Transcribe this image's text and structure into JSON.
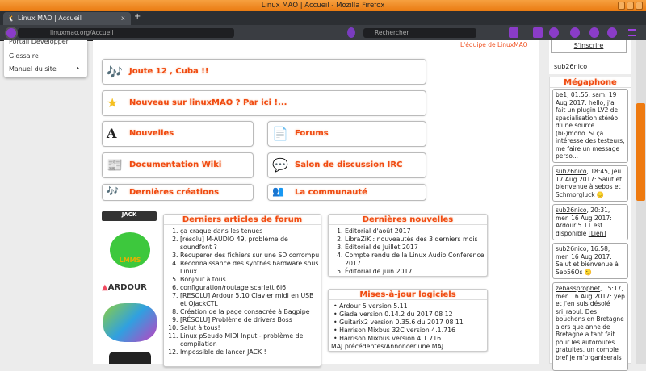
{
  "window": {
    "title": "Linux MAO | Accueil - Mozilla Firefox"
  },
  "tab": {
    "label": "Linux MAO | Accueil",
    "close": "x",
    "new_tab": "+"
  },
  "nav": {
    "url": "linuxmao.org/Accueil",
    "search_placeholder": "Rechercher"
  },
  "sidebar": {
    "items": [
      {
        "label": "Portail Développer"
      },
      {
        "label": "Glossaire"
      },
      {
        "label": "Manuel du site"
      }
    ]
  },
  "main": {
    "signature": "L'équipe de LinuxMAO",
    "buttons": [
      {
        "label": "Joute 12 , Cuba !!"
      },
      {
        "label": "Nouveau sur linuxMAO ? Par ici !..."
      },
      {
        "label": "Nouvelles"
      },
      {
        "label": "Forums"
      },
      {
        "label": "Documentation Wiki"
      },
      {
        "label": "Salon de discussion IRC"
      },
      {
        "label": "Dernières créations"
      },
      {
        "label": "La communauté"
      }
    ],
    "logos": [
      "JACK",
      "LMMS",
      "ARDOUR"
    ],
    "forum": {
      "title": "Derniers articles de forum",
      "items": [
        "ça craque dans les tenues",
        "[résolu] M-AUDIO 49, problème de soundfont ?",
        "Recuperer des fichiers sur une SD corrompu",
        "Reconnaissance des synthés hardware sous Linux",
        "Bonjour à tous",
        "configuration/routage scarlett 6i6",
        "[RESOLU] Ardour 5.10 Clavier midi en USB et QjackCTL",
        "Création de la page consacrée à Bagpipe",
        "[RÉSOLU] Problème de drivers Boss",
        "Salut à tous!",
        "Linux pSeudo MIDI Input - problème de compilation",
        "Impossible de lancer JACK !"
      ]
    },
    "news": {
      "title": "Dernières nouvelles",
      "items": [
        "Editorial d'août 2017",
        "LibraZiK : nouveautés des 3 derniers mois",
        "Éditorial de Juillet 2017",
        "Compte rendu de la Linux Audio Conference 2017",
        "Éditorial de juin 2017"
      ]
    },
    "updates": {
      "title": "Mises-à-jour logiciels",
      "items": [
        "Ardour 5 version 5.11",
        "Giada version 0.14.2 du 2017 08 12",
        "Guitarix2 version 0.35.6 du 2017 08 11",
        "Harrison Mixbus 32C version 4.1.716",
        "Harrison Mixbus version 4.1.716"
      ],
      "link": "MAJ précédentes/Annoncer une MAJ"
    }
  },
  "right": {
    "signup": "S'inscrire",
    "user": "sub26nico",
    "megaphone": {
      "title": "Mégaphone",
      "messages": [
        {
          "author": "be1",
          "text": ", 01:55, sam. 19 Aug 2017: hello, j'ai fait un plugin LV2 de spacialisation stéréo d'une source (bi-)mono. Si ça intéresse des testeurs, me faire un message perso..."
        },
        {
          "author": "sub26nico",
          "text": ", 18:45, jeu. 17 Aug 2017: Salut et bienvenue à sebos et Schmorgluck 🙂"
        },
        {
          "author": "sub26nico",
          "text": ", 20:31, mer. 16 Aug 2017: Ardour 5.11 est disponible ",
          "link": "[Lien]"
        },
        {
          "author": "sub26nico",
          "text": ", 16:58, mer. 16 Aug 2017: Salut et bienvenue à Seb56Os 🙂"
        },
        {
          "author": "zebassprophet",
          "text": ", 15:17, mer. 16 Aug 2017: yep et j'en suis désolé sri_raoul. Des bouchons en Bretagne alors que anne de Bretagne a tant fait pour les autoroutes gratuites, un comble bref je m'organiserais"
        }
      ]
    }
  }
}
